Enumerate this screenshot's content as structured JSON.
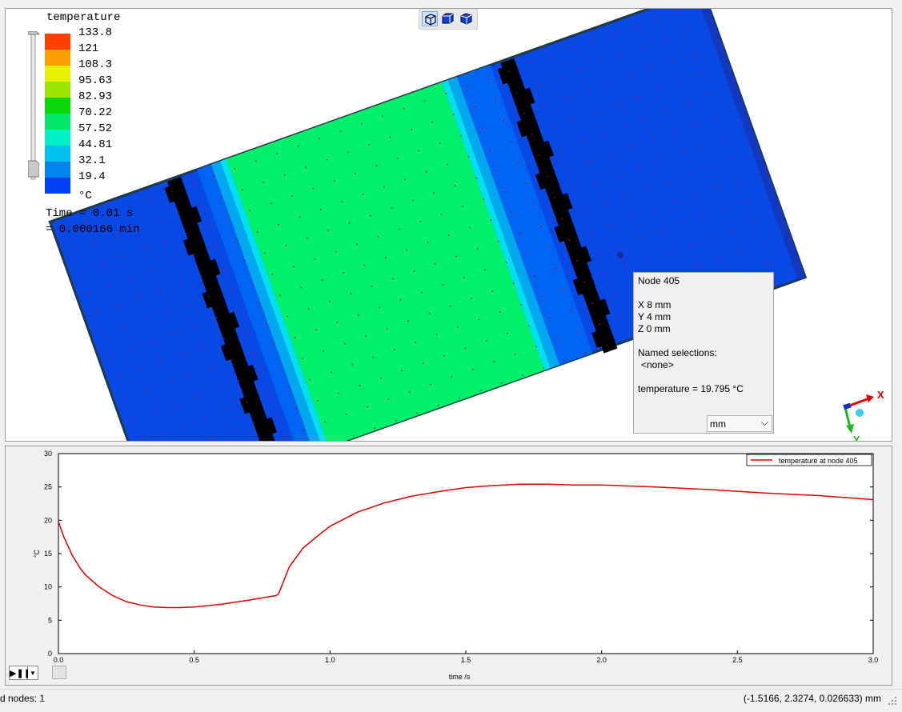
{
  "legend": {
    "title": "temperature",
    "unit": "°C",
    "labels": [
      "133.8",
      "121",
      "108.3",
      "95.63",
      "82.93",
      "70.22",
      "57.52",
      "44.81",
      "32.1",
      "19.4"
    ],
    "colors": [
      "#ff4000",
      "#ff9e00",
      "#e8f000",
      "#9be400",
      "#08d808",
      "#00e86a",
      "#00f0c8",
      "#00c0f0",
      "#0085f0",
      "#0040f0"
    ]
  },
  "time": {
    "line1": "Time = 0.01 s",
    "line2": "= 0.000166 min"
  },
  "view_toolbar": {
    "icons": [
      "iso-view-icon",
      "front-view-icon",
      "shaded-cube-icon"
    ]
  },
  "node_popup": {
    "title": "Node  405",
    "x": "X  8 mm",
    "y": "Y  4 mm",
    "z": "Z  0 mm",
    "named_label": "Named selections:",
    "named_value": "<none>",
    "temperature": "temperature = 19.795 °C",
    "unit": "mm"
  },
  "axis_triad": {
    "x_label": "X",
    "y_label": "Y"
  },
  "chart_data": {
    "type": "line",
    "xlabel": "time /s",
    "ylabel": "°C",
    "xlim": [
      0,
      3.0
    ],
    "ylim": [
      0,
      30
    ],
    "x_ticks": [
      "0.0",
      "0.5",
      "1.0",
      "1.5",
      "2.0",
      "2.5",
      "3.0"
    ],
    "y_ticks": [
      "0",
      "5",
      "10",
      "15",
      "20",
      "25",
      "30"
    ],
    "legend_position": "top-right",
    "series": [
      {
        "name": "temperature at node 405",
        "color": "#e00000",
        "x": [
          0.0,
          0.02,
          0.05,
          0.08,
          0.1,
          0.15,
          0.2,
          0.25,
          0.3,
          0.35,
          0.4,
          0.45,
          0.5,
          0.6,
          0.7,
          0.8,
          0.81,
          0.85,
          0.9,
          0.95,
          1.0,
          1.1,
          1.2,
          1.3,
          1.4,
          1.5,
          1.6,
          1.7,
          1.8,
          1.9,
          2.0,
          2.2,
          2.4,
          2.6,
          2.8,
          3.0
        ],
        "y": [
          19.8,
          17.5,
          14.8,
          12.8,
          11.8,
          10.0,
          8.7,
          7.8,
          7.3,
          7.0,
          6.9,
          6.9,
          7.0,
          7.4,
          8.0,
          8.7,
          8.9,
          13.0,
          15.8,
          17.5,
          19.1,
          21.2,
          22.6,
          23.6,
          24.3,
          24.9,
          25.2,
          25.4,
          25.4,
          25.3,
          25.3,
          25.0,
          24.6,
          24.1,
          23.7,
          23.1
        ]
      }
    ]
  },
  "status": {
    "left": "d nodes: 1",
    "right": "(-1.5166, 2.3274, 0.026633) mm"
  }
}
